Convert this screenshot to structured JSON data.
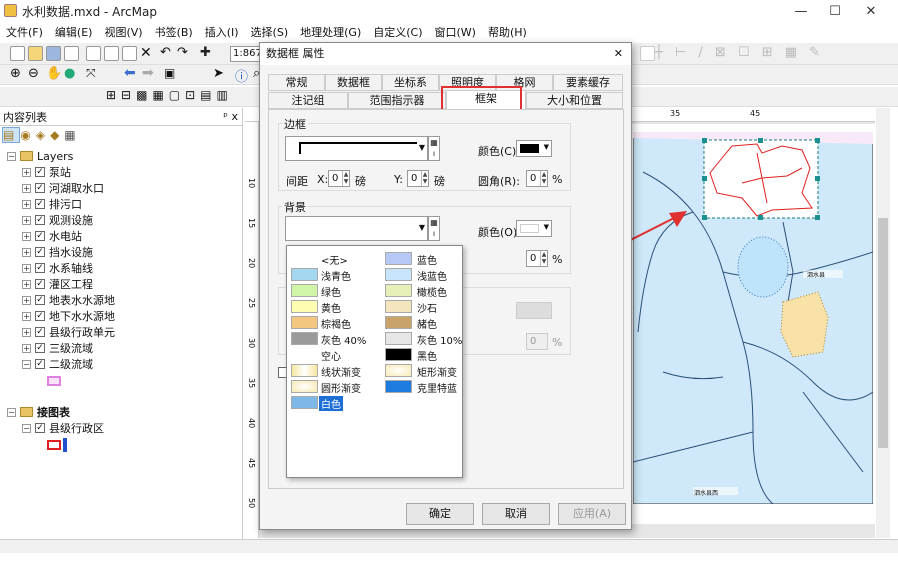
{
  "window": {
    "title": "水利数据.mxd - ArcMap",
    "minimize": "—",
    "maximize": "☐",
    "close": "✕"
  },
  "menu": [
    "文件(F)",
    "编辑(E)",
    "视图(V)",
    "书签(B)",
    "插入(I)",
    "选择(S)",
    "地理处理(G)",
    "自定义(C)",
    "窗口(W)",
    "帮助(H)"
  ],
  "toolbar": {
    "scale": "1:867..."
  },
  "toc": {
    "title": "内容列表",
    "pin": "ᵖ x",
    "group1": "Layers",
    "layers": [
      "泵站",
      "河湖取水口",
      "排污口",
      "观测设施",
      "水电站",
      "挡水设施",
      "水系轴线",
      "灌区工程",
      "地表水水源地",
      "地下水水源地",
      "县级行政单元",
      "三级流域",
      "二级流域"
    ],
    "group2": "接图表",
    "sub_layer": "县级行政区"
  },
  "ruler": {
    "top": [
      "35",
      "45"
    ],
    "left": [
      "10",
      "15",
      "20",
      "25",
      "30",
      "35",
      "40",
      "45",
      "50"
    ]
  },
  "map": {
    "labels": [
      "泗水县",
      "泗水县西"
    ]
  },
  "dialog": {
    "title": "数据框 属性",
    "close": "✕",
    "tabs_row1": [
      "常规",
      "数据框",
      "坐标系",
      "照明度",
      "格网",
      "要素缓存"
    ],
    "tabs_row2": [
      "注记组",
      "范围指示器",
      "框架",
      "大小和位置"
    ],
    "border_group": "边框",
    "color_label": "颜色(C):",
    "gap_label": "间距",
    "x_label": "X:",
    "x_value": "0",
    "y_label": "Y:",
    "y_value": "0",
    "unit": "磅",
    "round_label": "圆角(R):",
    "round_value": "0",
    "percent": "%",
    "background_group": "背景",
    "bg_color_label": "颜色(O):",
    "ok": "确定",
    "cancel": "取消",
    "apply": "应用(A)"
  },
  "popup": {
    "items_left": [
      "<无>",
      "浅青色",
      "绿色",
      "黄色",
      "棕褐色",
      "灰色 40%",
      "空心",
      "线状渐变",
      "圆形渐变",
      "白色"
    ],
    "items_right": [
      "蓝色",
      "浅蓝色",
      "橄榄色",
      "沙石",
      "赭色",
      "灰色 10%",
      "黑色",
      "矩形渐变",
      "克里特蓝"
    ],
    "colors_left": [
      "",
      "#a3d8f0",
      "#d1f5a8",
      "#fdfcb0",
      "#f3c682",
      "#9a9a9a",
      "",
      "#f5e7a0",
      "#f7e8b0",
      "#7fb7e8"
    ],
    "colors_right": [
      "#b6c8f5",
      "#c8e5fb",
      "#e6efb8",
      "#f5e5be",
      "#c9a36a",
      "#e6e6e6",
      "#000000",
      "#f8eab6",
      "#1e7be0"
    ]
  }
}
